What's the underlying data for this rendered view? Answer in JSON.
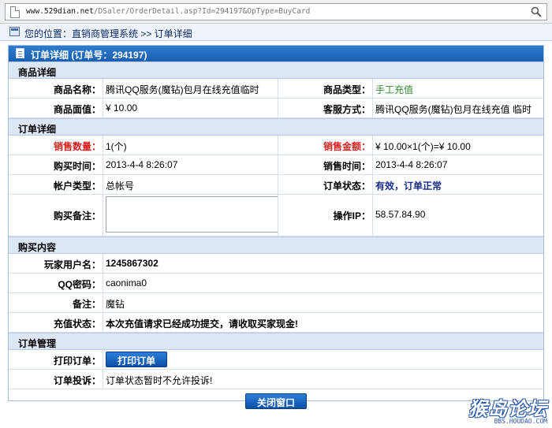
{
  "browser": {
    "url_main": "www.529dian.net",
    "url_rest": "/DSaler/OrderDetail.asp?Id=294197&OpType=BuyCard"
  },
  "breadcrumb": {
    "text": "您的位置：直销商管理系统 >> 订单详细"
  },
  "panel": {
    "title": "订单详细 (订单号：294197)"
  },
  "sections": {
    "goods": "商品详细",
    "order": "订单详细",
    "purchase": "购买内容",
    "manage": "订单管理"
  },
  "goods": {
    "name_label": "商品名称：",
    "name_value": "腾讯QQ服务(魔钻)包月在线充值临时",
    "type_label": "商品类型：",
    "type_value": "手工充值",
    "face_label": "商品面值：",
    "face_value": "¥ 10.00",
    "service_label": "客服方式：",
    "service_value": "腾讯QQ服务(魔钻)包月在线充值 临时"
  },
  "order": {
    "qty_label": "销售数量：",
    "qty_value": "1(个)",
    "amount_label": "销售金额：",
    "amount_value": "¥ 10.00×1(个)=¥ 10.00",
    "buy_time_label": "购买时间：",
    "buy_time_value": "2013-4-4 8:26:07",
    "sale_time_label": "销售时间：",
    "sale_time_value": "2013-4-4 8:26:07",
    "account_label": "帐户类型：",
    "account_value": "总帐号",
    "status_label": "订单状态：",
    "status_value": "有效，订单正常",
    "remark_label": "购买备注：",
    "remark_value": "",
    "ip_label": "操作IP：",
    "ip_value": "58.57.84.90"
  },
  "purchase": {
    "player_label": "玩家用户名：",
    "player_value": "1245867302",
    "qqpwd_label": "QQ密码：",
    "qqpwd_value": "caonima0",
    "note_label": "备注：",
    "note_value": "魔钻",
    "status_label": "充值状态：",
    "status_value": "本次充值请求已经成功提交，请收取买家现金!"
  },
  "manage": {
    "print_label": "打印订单：",
    "print_button": "打印订单",
    "complaint_label": "订单投诉：",
    "complaint_value": "订单状态暂时不允许投诉!"
  },
  "close_button": "关闭窗口",
  "watermark": {
    "big": "猴岛论坛",
    "small": "BBS.HOUDAO.COM"
  },
  "colors": {
    "header_blue": "#1a5fae",
    "section_bg": "#dce6f4",
    "red": "#d81e1e",
    "green": "#2f8a2f",
    "navy": "#1a2f8a"
  }
}
